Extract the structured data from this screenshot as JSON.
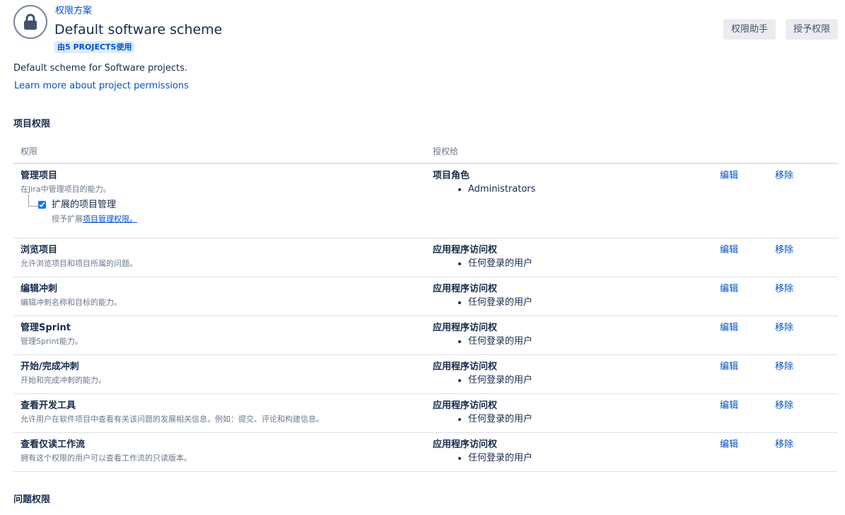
{
  "header": {
    "breadcrumb": "权限方案",
    "title": "Default software scheme",
    "usage_badge": "由5 PROJECTS使用",
    "helper_button": "权限助手",
    "grant_button": "授予权限",
    "icon": "lock-icon"
  },
  "scheme": {
    "description": "Default scheme for Software projects.",
    "learn_more": "Learn more about project permissions"
  },
  "sections": {
    "project_permissions": "项目权限",
    "issue_permissions": "问题权限"
  },
  "table": {
    "col_permission": "权限",
    "col_granted_to": "授权给",
    "rows": [
      {
        "name": "管理项目",
        "desc": "在Jira中管理项目的能力。",
        "sub": {
          "label": "扩展的项目管理",
          "checked": true,
          "desc_prefix": "授予扩展",
          "desc_link": "项目管理权限。"
        },
        "grant_type": "项目角色",
        "grantee": "Administrators",
        "edit": "编辑",
        "remove": "移除"
      },
      {
        "name": "浏览项目",
        "desc": "允许浏览项目和项目所属的问题。",
        "grant_type": "应用程序访问权",
        "grantee": "任何登录的用户",
        "edit": "编辑",
        "remove": "移除"
      },
      {
        "name": "编辑冲刺",
        "desc": "编辑冲刺名称和目标的能力。",
        "grant_type": "应用程序访问权",
        "grantee": "任何登录的用户",
        "edit": "编辑",
        "remove": "移除"
      },
      {
        "name": "管理Sprint",
        "desc": "管理Sprint能力。",
        "grant_type": "应用程序访问权",
        "grantee": "任何登录的用户",
        "edit": "编辑",
        "remove": "移除"
      },
      {
        "name": "开始/完成冲刺",
        "desc": "开始和完成冲刺的能力。",
        "grant_type": "应用程序访问权",
        "grantee": "任何登录的用户",
        "edit": "编辑",
        "remove": "移除"
      },
      {
        "name": "查看开发工具",
        "desc": "允许用户在软件项目中查看有关该问题的发展相关信息，例如：提交、评论和构建信息。",
        "grant_type": "应用程序访问权",
        "grantee": "任何登录的用户",
        "edit": "编辑",
        "remove": "移除"
      },
      {
        "name": "查看仅读工作流",
        "desc": "拥有这个权限的用户可以查看工作流的只读版本。",
        "grant_type": "应用程序访问权",
        "grantee": "任何登录的用户",
        "edit": "编辑",
        "remove": "移除"
      }
    ]
  },
  "colors": {
    "link": "#0052cc",
    "text": "#172b4d",
    "subtle": "#6b778c",
    "badge_bg": "#deebff",
    "button_bg": "#ebecf0",
    "border": "#dfe1e6"
  }
}
